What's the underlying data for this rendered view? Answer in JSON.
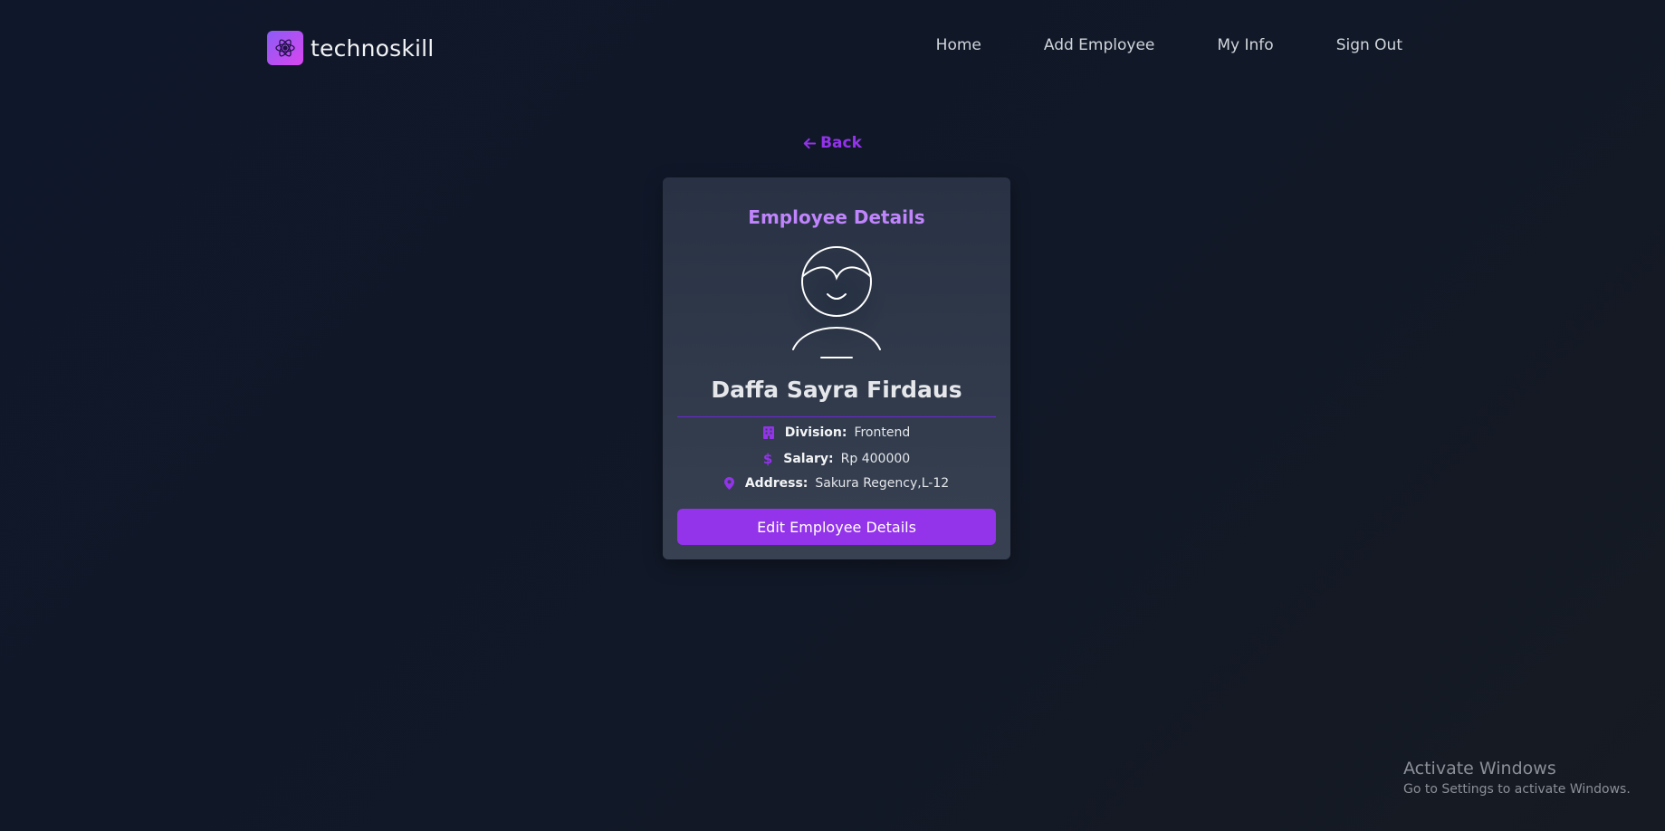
{
  "brand": {
    "name": "technoskill"
  },
  "nav": {
    "items": [
      "Home",
      "Add Employee",
      "My Info",
      "Sign Out"
    ]
  },
  "back": {
    "label": "Back"
  },
  "card": {
    "title": "Employee Details",
    "employee_name": "Daffa Sayra Firdaus",
    "division_label": "Division:",
    "division_value": "Frontend",
    "salary_label": "Salary:",
    "salary_value": "Rp 400000",
    "address_label": "Address:",
    "address_value": "Sakura Regency,L-12",
    "edit_button": "Edit Employee Details"
  },
  "watermark": {
    "line1": "Activate Windows",
    "line2": "Go to Settings to activate Windows."
  },
  "colors": {
    "accent": "#9333ea",
    "title_accent": "#c084fc",
    "background": "#111827",
    "card": "#374151"
  },
  "icons": {
    "logo": "atom-logo-icon",
    "back": "arrow-left-icon",
    "division": "building-icon",
    "salary": "dollar-icon",
    "address": "map-pin-icon",
    "avatar": "user-avatar-icon"
  }
}
